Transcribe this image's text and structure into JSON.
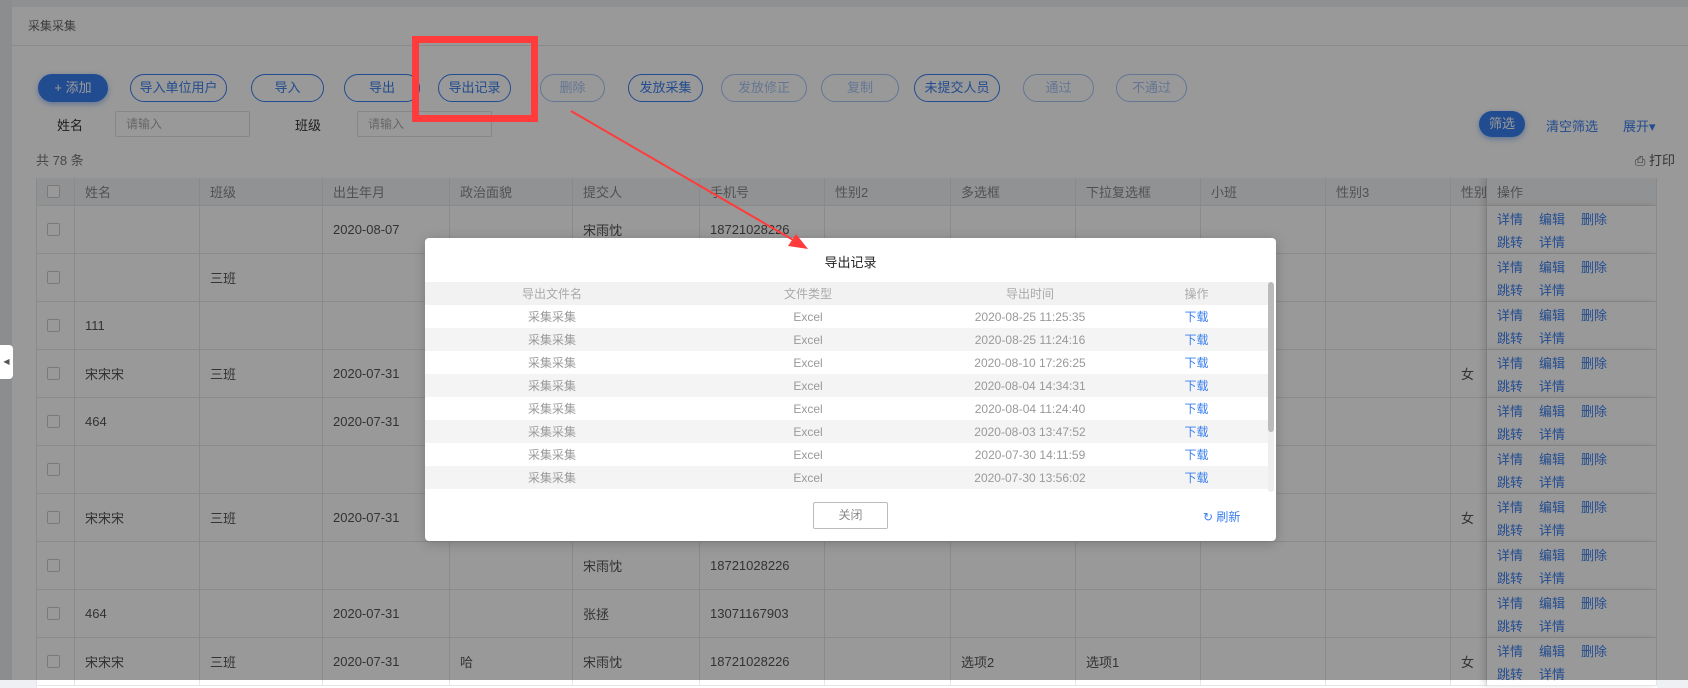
{
  "page_title": "采集采集",
  "toolbar": [
    {
      "label": "+ 添加",
      "state": "primary",
      "name": "add-button"
    },
    {
      "label": "导入单位用户",
      "state": "normal",
      "name": "import-unit-users-button"
    },
    {
      "label": "导入",
      "state": "normal",
      "name": "import-button"
    },
    {
      "label": "导出",
      "state": "normal",
      "name": "export-button"
    },
    {
      "label": "导出记录",
      "state": "normal",
      "name": "export-records-button"
    },
    {
      "label": "删除",
      "state": "disabled",
      "name": "delete-button"
    },
    {
      "label": "发放采集",
      "state": "normal",
      "name": "issue-collection-button"
    },
    {
      "label": "发放修正",
      "state": "disabled",
      "name": "issue-correction-button"
    },
    {
      "label": "复制",
      "state": "disabled",
      "name": "copy-button"
    },
    {
      "label": "未提交人员",
      "state": "normal",
      "name": "unsubmitted-button"
    },
    {
      "label": "通过",
      "state": "disabled",
      "name": "approve-button"
    },
    {
      "label": "不通过",
      "state": "disabled",
      "name": "reject-button"
    }
  ],
  "filters": {
    "name_label": "姓名",
    "name_placeholder": "请输入",
    "class_label": "班级",
    "class_placeholder": "请输入",
    "filter_btn": "筛选",
    "clear_btn": "清空筛选",
    "expand_btn": "展开▾"
  },
  "count_text": "共 78 条",
  "print_label": "打印",
  "table": {
    "columns": [
      "姓名",
      "班级",
      "出生年月",
      "政治面貌",
      "提交人",
      "手机号",
      "性别2",
      "多选框",
      "下拉复选框",
      "小班",
      "性别3",
      "性别",
      "操作"
    ],
    "rows": [
      [
        "",
        "",
        "2020-08-07",
        "",
        "宋雨忱",
        "18721028226",
        "",
        "",
        "",
        "",
        "",
        ""
      ],
      [
        "",
        "三班",
        "",
        "",
        "",
        "",
        "",
        "",
        "",
        "",
        "",
        ""
      ],
      [
        "111",
        "",
        "",
        "",
        "",
        "",
        "",
        "",
        "",
        "",
        "",
        ""
      ],
      [
        "宋宋宋",
        "三班",
        "2020-07-31",
        "",
        "",
        "",
        "",
        "",
        "",
        "",
        "",
        "女"
      ],
      [
        "464",
        "",
        "2020-07-31",
        "",
        "",
        "",
        "",
        "",
        "",
        "",
        "",
        ""
      ],
      [
        "",
        "",
        "",
        "",
        "",
        "",
        "",
        "",
        "",
        "",
        "",
        ""
      ],
      [
        "宋宋宋",
        "三班",
        "2020-07-31",
        "",
        "",
        "",
        "",
        "",
        "",
        "",
        "",
        "女"
      ],
      [
        "",
        "",
        "",
        "",
        "宋雨忱",
        "18721028226",
        "",
        "",
        "",
        "",
        "",
        ""
      ],
      [
        "464",
        "",
        "2020-07-31",
        "",
        "张拯",
        "13071167903",
        "",
        "",
        "",
        "",
        "",
        ""
      ],
      [
        "宋宋宋",
        "三班",
        "2020-07-31",
        "哈",
        "宋雨忱",
        "18721028226",
        "",
        "选项2",
        "选项1",
        "",
        "",
        "女"
      ]
    ],
    "ops_line1": [
      "详情",
      "编辑",
      "删除"
    ],
    "ops_line2": [
      "跳转",
      "详情"
    ]
  },
  "dialog": {
    "title": "导出记录",
    "columns": [
      "导出文件名",
      "文件类型",
      "导出时间",
      "操作"
    ],
    "rows": [
      [
        "采集采集",
        "Excel",
        "2020-08-25 11:25:35",
        "下载"
      ],
      [
        "采集采集",
        "Excel",
        "2020-08-25 11:24:16",
        "下载"
      ],
      [
        "采集采集",
        "Excel",
        "2020-08-10 17:26:25",
        "下载"
      ],
      [
        "采集采集",
        "Excel",
        "2020-08-04 14:34:31",
        "下载"
      ],
      [
        "采集采集",
        "Excel",
        "2020-08-04 11:24:40",
        "下载"
      ],
      [
        "采集采集",
        "Excel",
        "2020-08-03 13:47:52",
        "下载"
      ],
      [
        "采集采集",
        "Excel",
        "2020-07-30 14:11:59",
        "下载"
      ],
      [
        "采集采集",
        "Excel",
        "2020-07-30 13:56:02",
        "下载"
      ]
    ],
    "close_label": "关闭",
    "refresh_label": "刷新"
  },
  "colors": {
    "accent": "#3a7ff0",
    "annotation": "#ff3b3b"
  }
}
